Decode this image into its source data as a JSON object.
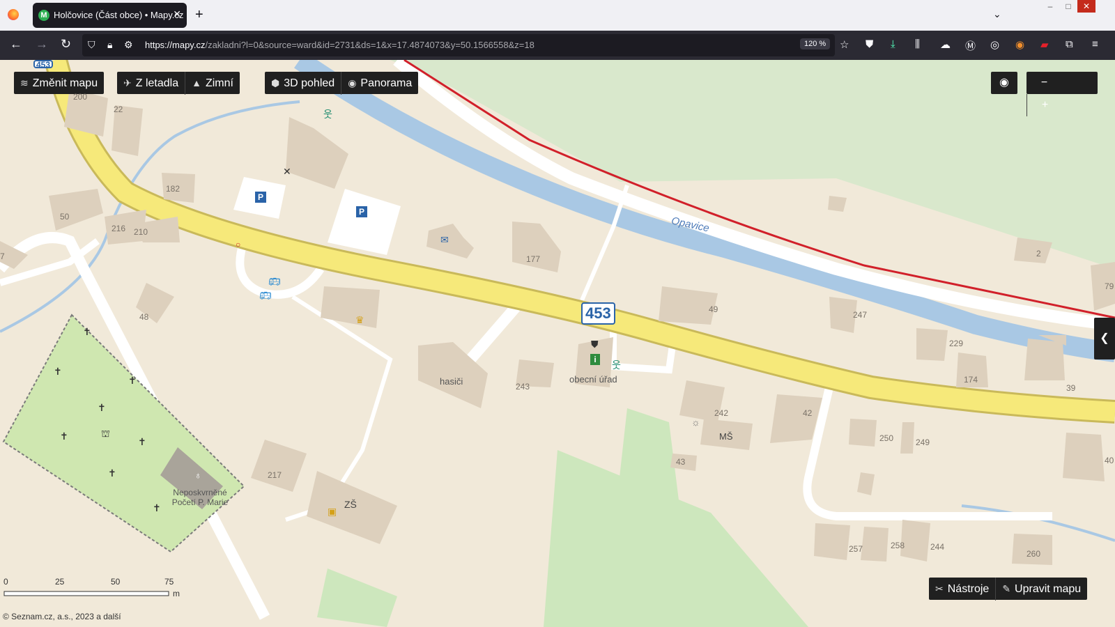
{
  "browser": {
    "tab_title": "Holčovice (Část obce) • Mapy.cz",
    "tab_favicon": "M",
    "url_host": "https://mapy.cz",
    "url_path": "/zakladni?l=0&source=ward&id=2731&ds=1&x=17.4874073&y=50.1566558&z=18",
    "zoom": "120 %",
    "icons": [
      "back-icon",
      "forward-icon",
      "reload-icon",
      "shield-icon",
      "lock-icon",
      "permissions-icon",
      "star-icon",
      "pocket-icon",
      "download-icon",
      "library-icon",
      "extension-icon",
      "account-icon",
      "mask-icon",
      "rss-icon",
      "pdf-icon",
      "puzzle-icon",
      "menu-icon"
    ]
  },
  "map_controls": {
    "change_map": "Změnit mapu",
    "aerial": "Z letadla",
    "winter": "Zimní",
    "view3d": "3D pohled",
    "panorama": "Panorama",
    "tools": "Nástroje",
    "edit_map": "Upravit mapu",
    "zoom_out": "−",
    "zoom_in": "+"
  },
  "map_labels": {
    "road_number": "453",
    "road_number_partial": "453",
    "river": "Opavice",
    "fire_station": "hasiči",
    "town_hall": "obecní úřad",
    "school": "ZŠ",
    "kindergarten": "MŠ",
    "church": "Neposkvrněné Početí P. Marie",
    "house_numbers": [
      "200",
      "22",
      "182",
      "50",
      "216",
      "210",
      "177",
      "48",
      "49",
      "247",
      "229",
      "174",
      "39",
      "243",
      "242",
      "42",
      "250",
      "249",
      "43",
      "217",
      "257",
      "258",
      "244",
      "260",
      "2",
      "79",
      "40",
      "7"
    ]
  },
  "scale": {
    "ticks": [
      "0",
      "25",
      "50",
      "75"
    ],
    "unit": "m"
  },
  "attribution": "© Seznam.cz, a.s., 2023 a další",
  "colors": {
    "main_road": "#f6e97a",
    "river": "#a9c8e4",
    "railway": "#d1202a",
    "cemetery": "#cfe7b0",
    "grass": "#cde7bd",
    "land": "#f1e9d9",
    "building": "#ddd0bd"
  }
}
